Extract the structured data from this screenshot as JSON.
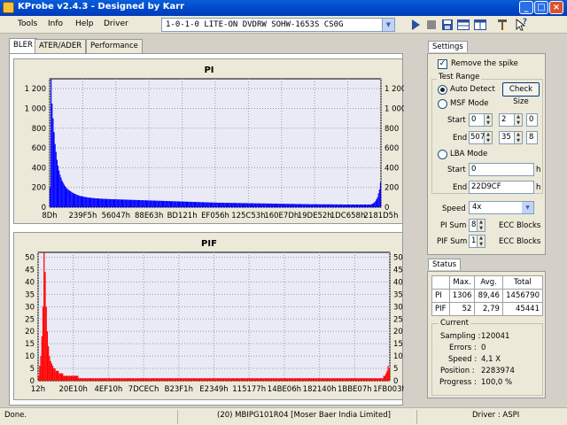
{
  "window": {
    "title": "KProbe v2.4.3 - Designed by Karr"
  },
  "menu": {
    "items": [
      "Tools",
      "Info",
      "Help",
      "Driver"
    ]
  },
  "drive": {
    "selected": "1-0-1-0 LITE-ON DVDRW SOHW-1653S CS0G"
  },
  "toolbar": {
    "icons": [
      "play-icon",
      "stop-icon",
      "save-icon",
      "layout-icon",
      "window-icon",
      "tools-icon",
      "help-icon"
    ]
  },
  "tabs": [
    "BLER",
    "ATER/ADER",
    "Performance"
  ],
  "charts": {
    "pi": {
      "title": "PI"
    },
    "pif": {
      "title": "PIF"
    }
  },
  "chart_data": [
    {
      "type": "area",
      "title": "PI",
      "ylim": [
        0,
        1300
      ],
      "yticks": [
        0,
        200,
        400,
        600,
        800,
        1000,
        1200
      ],
      "ytick_labels": [
        "0",
        "200",
        "400",
        "600",
        "800",
        "1 000",
        "1 200"
      ],
      "xtick_labels": [
        "8Dh",
        "239F5h",
        "56047h",
        "88E63h",
        "BD121h",
        "EF056h",
        "125C53h",
        "160E7Dh",
        "19DE52h",
        "1DC658h",
        "2181D5h"
      ],
      "series": [
        {
          "color": "#0000ff",
          "values": [
            200,
            1306,
            1050,
            900,
            760,
            640,
            560,
            480,
            420,
            370,
            330,
            300,
            270,
            250,
            230,
            215,
            200,
            190,
            180,
            172,
            165,
            158,
            150,
            145,
            140,
            135,
            130,
            126,
            122,
            118,
            115,
            112,
            110,
            108,
            106,
            104,
            102,
            100,
            98,
            97,
            96,
            95,
            94,
            93,
            92,
            91,
            90,
            89,
            88,
            88,
            87,
            86,
            86,
            85,
            85,
            84,
            84,
            83,
            83,
            82,
            82,
            81,
            81,
            81,
            80,
            80,
            80,
            79,
            79,
            79,
            78,
            78,
            78,
            77,
            77,
            77,
            76,
            76,
            76,
            75,
            75,
            75,
            74,
            74,
            74,
            73,
            73,
            73,
            72,
            72,
            72,
            71,
            71,
            71,
            70,
            70,
            70,
            69,
            69,
            69,
            68,
            68,
            68,
            67,
            67,
            67,
            66,
            66,
            66,
            65,
            65,
            65,
            64,
            64,
            64,
            63,
            63,
            63,
            62,
            62,
            62,
            61,
            61,
            61,
            60,
            60,
            60,
            59,
            59,
            59,
            58,
            58,
            58,
            57,
            57,
            57,
            56,
            56,
            56,
            55,
            55,
            55,
            54,
            54,
            54,
            53,
            53,
            53,
            52,
            52,
            52,
            51,
            51,
            51,
            50,
            50,
            50,
            49,
            49,
            49,
            48,
            48,
            48,
            47,
            47,
            47,
            46,
            46,
            46,
            45,
            45,
            45,
            45,
            45,
            45,
            44,
            44,
            44,
            44,
            44,
            44,
            43,
            43,
            43,
            43,
            43,
            43,
            42,
            42,
            42,
            42,
            42,
            42,
            41,
            41,
            41,
            41,
            41,
            41,
            40,
            40,
            40,
            40,
            40,
            40,
            39,
            39,
            39,
            39,
            39,
            39,
            38,
            38,
            38,
            38,
            38,
            38,
            37,
            37,
            37,
            37,
            37,
            37,
            36,
            36,
            36,
            36,
            36,
            36,
            35,
            35,
            35,
            35,
            35,
            35,
            34,
            34,
            34,
            34,
            34,
            34,
            33,
            33,
            33,
            33,
            33,
            33,
            32,
            32,
            32,
            32,
            32,
            32,
            31,
            31,
            31,
            31,
            31,
            31,
            30,
            30,
            30,
            30,
            30,
            30,
            30,
            30,
            30,
            30,
            30,
            30,
            29,
            29,
            29,
            29,
            29,
            29,
            29,
            29,
            29,
            29,
            29,
            29,
            28,
            28,
            28,
            28,
            28,
            28,
            28,
            28,
            28,
            28,
            28,
            28,
            27,
            27,
            27,
            27,
            27,
            27,
            27,
            27,
            27,
            27,
            27,
            27,
            27,
            27,
            27,
            27,
            27,
            27,
            27,
            27,
            27,
            27,
            27,
            27,
            27,
            27,
            27,
            27,
            30,
            35,
            40,
            50,
            60,
            80,
            100,
            140,
            180,
            250
          ]
        }
      ]
    },
    {
      "type": "bar",
      "title": "PIF",
      "ylim": [
        0,
        52
      ],
      "yticks": [
        0,
        5,
        10,
        15,
        20,
        25,
        30,
        35,
        40,
        45,
        50
      ],
      "ytick_labels": [
        "0",
        "5",
        "10",
        "15",
        "20",
        "25",
        "30",
        "35",
        "40",
        "45",
        "50"
      ],
      "xtick_labels": [
        "12h",
        "20E10h",
        "4EF10h",
        "7DCECh",
        "B23F1h",
        "E2349h",
        "115177h",
        "14BE06h",
        "182140h",
        "1BBE07h",
        "1FB003h"
      ],
      "series": [
        {
          "color": "#ff0000",
          "values": [
            2,
            6,
            10,
            18,
            30,
            52,
            44,
            30,
            20,
            14,
            10,
            8,
            7,
            6,
            5,
            5,
            4,
            4,
            4,
            3,
            3,
            3,
            3,
            2,
            2,
            2,
            2,
            2,
            2,
            2,
            2,
            2,
            2,
            2,
            2,
            2,
            2,
            1,
            1,
            1,
            1,
            1,
            1,
            1,
            1,
            1,
            1,
            1,
            1,
            1,
            1,
            1,
            1,
            1,
            1,
            1,
            1,
            1,
            1,
            1,
            1,
            1,
            1,
            1,
            1,
            1,
            1,
            1,
            1,
            1,
            1,
            1,
            1,
            1,
            1,
            1,
            1,
            1,
            1,
            1,
            1,
            1,
            1,
            1,
            1,
            1,
            1,
            1,
            1,
            1,
            1,
            1,
            1,
            1,
            1,
            1,
            1,
            1,
            1,
            1,
            1,
            1,
            1,
            1,
            1,
            1,
            1,
            1,
            1,
            1,
            1,
            1,
            1,
            1,
            1,
            1,
            1,
            1,
            1,
            1,
            1,
            1,
            1,
            1,
            1,
            1,
            1,
            1,
            1,
            1,
            1,
            1,
            1,
            1,
            1,
            1,
            1,
            1,
            1,
            1,
            1,
            1,
            1,
            1,
            1,
            1,
            1,
            1,
            1,
            1,
            1,
            1,
            1,
            1,
            1,
            1,
            1,
            1,
            1,
            1,
            1,
            1,
            1,
            1,
            1,
            1,
            1,
            1,
            1,
            1,
            1,
            1,
            1,
            1,
            1,
            1,
            1,
            1,
            1,
            1,
            1,
            1,
            1,
            1,
            1,
            1,
            1,
            1,
            1,
            1,
            1,
            1,
            1,
            1,
            1,
            1,
            1,
            1,
            1,
            1,
            1,
            1,
            1,
            1,
            1,
            1,
            1,
            1,
            1,
            1,
            1,
            1,
            1,
            1,
            1,
            1,
            1,
            1,
            1,
            1,
            1,
            1,
            1,
            1,
            1,
            1,
            1,
            1,
            1,
            1,
            1,
            1,
            1,
            1,
            1,
            1,
            1,
            1,
            1,
            1,
            1,
            1,
            1,
            1,
            1,
            1,
            1,
            1,
            1,
            1,
            1,
            1,
            1,
            1,
            1,
            1,
            1,
            1,
            1,
            1,
            1,
            1,
            1,
            1,
            1,
            1,
            1,
            1,
            1,
            1,
            1,
            1,
            1,
            1,
            1,
            1,
            1,
            1,
            1,
            1,
            1,
            1,
            1,
            1,
            1,
            1,
            1,
            1,
            1,
            1,
            1,
            1,
            1,
            1,
            1,
            1,
            1,
            1,
            1,
            1,
            1,
            1,
            1,
            1,
            1,
            1,
            1,
            1,
            1,
            1,
            1,
            1,
            1,
            1,
            1,
            1,
            1,
            2,
            2,
            3,
            4,
            6,
            5
          ]
        }
      ]
    }
  ],
  "settings": {
    "tab": "Settings",
    "remove_spike": "Remove the spike",
    "remove_spike_checked": true,
    "test_range": "Test Range",
    "auto_detect": "Auto Detect",
    "check_size": "Check Size",
    "msf_mode": "MSF Mode",
    "start": "Start",
    "end": "End",
    "msf_start": [
      "0",
      "2",
      "0"
    ],
    "msf_end": [
      "507",
      "35",
      "8"
    ],
    "lba_mode": "LBA Mode",
    "lba_start": "0",
    "lba_end": "22D9CF",
    "h": "h",
    "speed_label": "Speed",
    "speed_value": "4x",
    "pi_sum_label": "PI Sum",
    "pi_sum_value": "8",
    "pif_sum_label": "PIF Sum",
    "pif_sum_value": "1",
    "ecc_blocks": "ECC Blocks"
  },
  "status": {
    "tab": "Status",
    "headers": [
      "",
      "Max.",
      "Avg.",
      "Total"
    ],
    "rows": [
      [
        "PI",
        "1306",
        "89,46",
        "1456790"
      ],
      [
        "PIF",
        "52",
        "2,79",
        "45441"
      ]
    ],
    "current": "Current",
    "sampling_label": "Sampling :",
    "sampling_value": "120041",
    "errors_label": "Errors :",
    "errors_value": "0",
    "speed_label": "Speed :",
    "speed_value": "4,1  X",
    "position_label": "Position :",
    "position_value": "2283974",
    "progress_label": "Progress :",
    "progress_value": "100,0 %"
  },
  "statusbar": {
    "left": "Done.",
    "disc": "(20) MBIPG101R04 [Moser Baer India Limited]",
    "driver": "Driver : ASPI"
  }
}
